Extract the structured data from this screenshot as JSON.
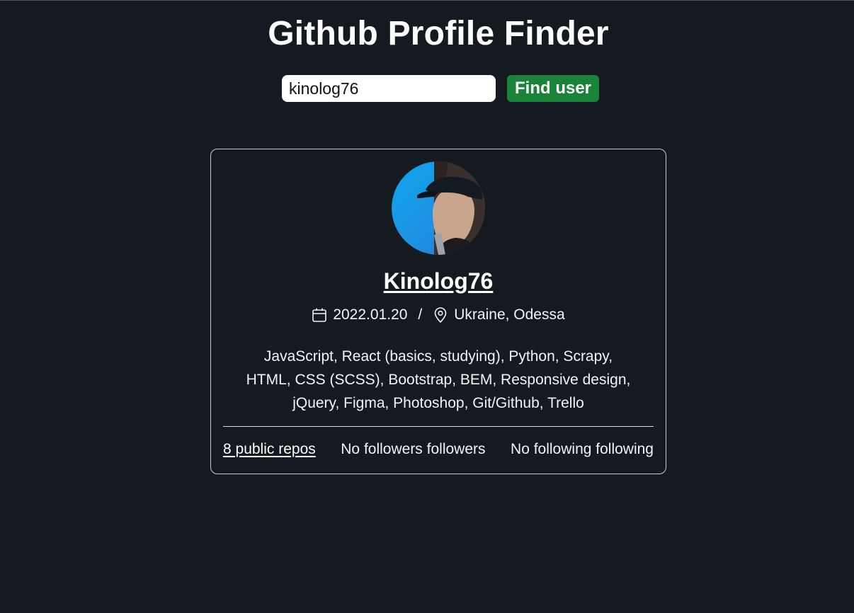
{
  "header": {
    "title": "Github Profile Finder"
  },
  "search": {
    "value": "kinolog76",
    "button_label": "Find user"
  },
  "profile": {
    "avatar_icon": "user-avatar-photo",
    "username": "Kinolog76",
    "joined_date": "2022.01.20",
    "separator": "/",
    "location": "Ukraine, Odessa",
    "calendar_icon": "calendar-icon",
    "location_icon": "map-pin-icon",
    "bio_lines": [
      "JavaScript, React (basics, studying), Python, Scrapy,",
      "HTML, CSS (SCSS), Bootstrap, BEM, Responsive design,",
      "jQuery, Figma, Photoshop, Git/Github, Trello"
    ],
    "stats": {
      "repos": "8 public repos",
      "followers": "No followers followers",
      "following": "No following following"
    }
  },
  "colors": {
    "background": "#151a21",
    "accent_button": "#198338",
    "card_border": "#c8ccd0"
  }
}
